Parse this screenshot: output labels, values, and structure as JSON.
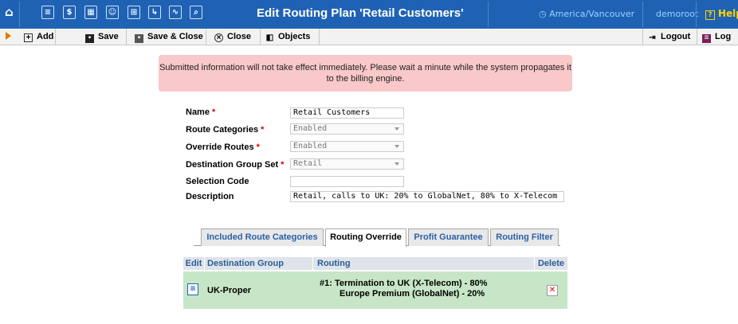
{
  "header": {
    "title": "Edit Routing Plan 'Retail Customers'",
    "timezone": "America/Vancouver",
    "user": "demoroot",
    "help_label": "Help",
    "icons": [
      "home-icon",
      "list-icon",
      "dollar-icon",
      "grid-icon",
      "person-icon",
      "split-icon",
      "route-icon",
      "chart-icon",
      "search-icon"
    ]
  },
  "toolbar": {
    "add_label": "Add",
    "save_label": "Save",
    "save_close_label": "Save & Close",
    "close_label": "Close",
    "objects_label": "Objects",
    "logout_label": "Logout",
    "log_label": "Log"
  },
  "notice": "Submitted information will not take effect immediately. Please wait a minute while the system propagates it to the billing engine.",
  "form": {
    "name": {
      "label": "Name",
      "value": "Retail Customers",
      "required": true
    },
    "route_categories": {
      "label": "Route Categories",
      "value": "Enabled",
      "required": true
    },
    "override_routes": {
      "label": "Override Routes",
      "value": "Enabled",
      "required": true
    },
    "destination_group_set": {
      "label": "Destination Group Set",
      "value": "Retail",
      "required": true
    },
    "selection_code": {
      "label": "Selection Code",
      "value": ""
    },
    "description": {
      "label": "Description",
      "value": "Retail, calls to UK: 20% to GlobalNet, 80% to X-Telecom"
    }
  },
  "tabs": [
    {
      "label": "Included Route Categories",
      "active": false
    },
    {
      "label": "Routing Override",
      "active": true
    },
    {
      "label": "Profit Guarantee",
      "active": false
    },
    {
      "label": "Routing Filter",
      "active": false
    }
  ],
  "table": {
    "headers": {
      "edit": "Edit",
      "destination_group": "Destination Group",
      "routing": "Routing",
      "delete": "Delete"
    },
    "rows": [
      {
        "destination_group": "UK-Proper",
        "routing_line1": "#1:  Termination to UK (X-Telecom) - 80%",
        "routing_line2": "Europe Premium (GlobalNet) - 20%"
      }
    ]
  },
  "colors": {
    "header_bg": "#1f62b4",
    "notice_bg": "#f9c8c8",
    "row_bg": "#c7e6c7",
    "required": "#dd0000"
  }
}
